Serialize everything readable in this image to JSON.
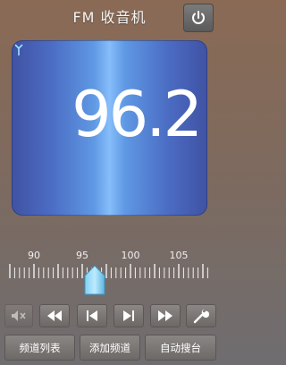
{
  "header": {
    "title": "FM 收音机",
    "power_icon": "power-icon"
  },
  "display": {
    "frequency": "96.2",
    "antenna_icon": "antenna-icon"
  },
  "tuner": {
    "scale_labels": [
      "90",
      "95",
      "100",
      "105"
    ],
    "current_frequency": 96.2,
    "range": [
      87.5,
      108
    ]
  },
  "controls": {
    "mute_icon": "mute-icon",
    "seek_back_icon": "fast-rewind-icon",
    "prev_icon": "skip-previous-icon",
    "next_icon": "skip-next-icon",
    "seek_forward_icon": "fast-forward-icon",
    "settings_icon": "wrench-icon"
  },
  "bottom_buttons": {
    "channel_list": "频道列表",
    "add_channel": "添加频道",
    "auto_search": "自动搜台"
  }
}
